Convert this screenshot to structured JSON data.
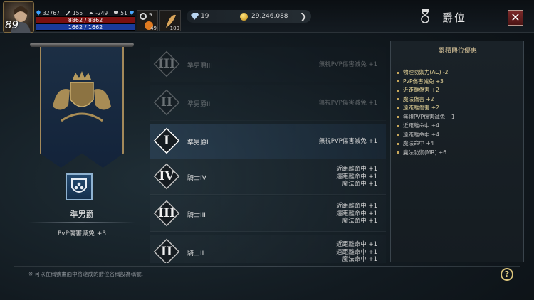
{
  "player": {
    "level": "89",
    "stat_a": "32767",
    "stat_b": "155",
    "stat_c": "-249",
    "stat_d": "51",
    "hp": "8862 / 8862",
    "mp": "1662 / 1662",
    "hp_fraction": 1.0,
    "mp_fraction": 1.0,
    "buff1_count": "9",
    "potion_count": "49",
    "item_count": "100"
  },
  "currency": {
    "diamond": "19",
    "gold": "29,246,088"
  },
  "header": {
    "title": "爵位",
    "close_glyph": "✕",
    "arrow_glyph": "❯"
  },
  "current_rank": {
    "name": "準男爵",
    "bonus": "PvP傷害減免 +3"
  },
  "ranks": [
    {
      "roman": "III",
      "title": "準男爵III",
      "effects": [
        "無視PVP傷害減免 +1"
      ],
      "state": "dim"
    },
    {
      "roman": "II",
      "title": "準男爵II",
      "effects": [
        "無視PVP傷害減免 +1"
      ],
      "state": "dim"
    },
    {
      "roman": "I",
      "title": "準男爵I",
      "effects": [
        "無視PVP傷害減免 +1"
      ],
      "state": "selected"
    },
    {
      "roman": "IV",
      "title": "騎士IV",
      "effects": [
        "近距離命中 +1",
        "遠距離命中 +1",
        "魔法命中 +1"
      ],
      "state": "normal"
    },
    {
      "roman": "III",
      "title": "騎士III",
      "effects": [
        "近距離命中 +1",
        "遠距離命中 +1",
        "魔法命中 +1"
      ],
      "state": "normal"
    },
    {
      "roman": "II",
      "title": "騎士II",
      "effects": [
        "近距離命中 +1",
        "遠距離命中 +1",
        "魔法命中 +1"
      ],
      "state": "normal"
    }
  ],
  "accumulated": {
    "header": "累積爵位優惠",
    "items": [
      {
        "text": "物理防禦力(AC) -2",
        "highlight": true
      },
      {
        "text": "PvP傷害減免 +3",
        "highlight": true
      },
      {
        "text": "近距離傷害 +2",
        "highlight": true
      },
      {
        "text": "魔法傷害 +2",
        "highlight": true
      },
      {
        "text": "遠距離傷害 +2",
        "highlight": true
      },
      {
        "text": "無視PVP傷害減免 +1",
        "highlight": false
      },
      {
        "text": "近距離命中 +4",
        "highlight": false
      },
      {
        "text": "遠距離命中 +4",
        "highlight": false
      },
      {
        "text": "魔法命中 +4",
        "highlight": false
      },
      {
        "text": "魔法防禦(MR) +6",
        "highlight": false
      }
    ]
  },
  "footer": {
    "note": "※ 可以在稱號畫面中將達成的爵位名稱設為稱號.",
    "help_glyph": "?"
  },
  "colors": {
    "accent_gold": "#d9c37a",
    "hp_red": "#7a1010",
    "mp_blue": "#1a3a9a",
    "close_red": "#7c2a2a"
  },
  "icons": [
    "player-avatar",
    "gem-icon",
    "sword-icon",
    "helmet-icon",
    "heart-icon",
    "gear-icon",
    "potion-icon",
    "diamond-icon",
    "gold-coin-icon",
    "arrow-right-icon",
    "medal-icon",
    "close-icon",
    "help-icon",
    "shield-rank-icon"
  ]
}
